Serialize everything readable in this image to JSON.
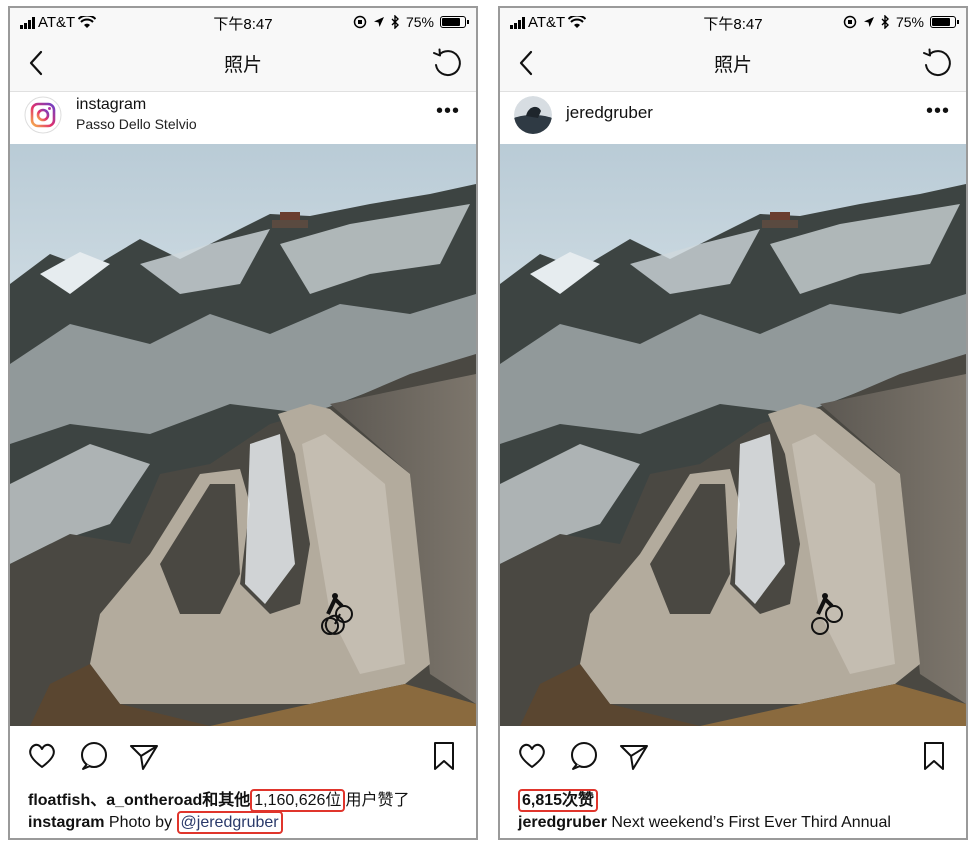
{
  "status_bar": {
    "carrier": "AT&T",
    "time": "下午8:47",
    "battery": "75%",
    "battery_level": 0.75
  },
  "nav": {
    "title": "照片"
  },
  "left_post": {
    "username": "instagram",
    "location": "Passo Dello Stelvio",
    "more": "•••",
    "likes_prefix": "floatfish、a_ontheroad和其他",
    "likes_count": "1,160,626位",
    "likes_suffix": "用户赞了",
    "caption_user": "instagram",
    "caption_text": " Photo by ",
    "caption_mention": "@jeredgruber"
  },
  "right_post": {
    "username": "jeredgruber",
    "more": "•••",
    "likes": "6,815次赞",
    "caption_user": "jeredgruber",
    "caption_text": " Next weekend’s First Ever Third Annual"
  },
  "colors": {
    "highlight": "#e0352c",
    "mention": "#2a3a6a",
    "bar_bg": "#f8f8f8"
  },
  "icons": [
    "back-icon",
    "refresh-icon",
    "more-icon",
    "heart-icon",
    "comment-icon",
    "share-icon",
    "bookmark-icon"
  ]
}
